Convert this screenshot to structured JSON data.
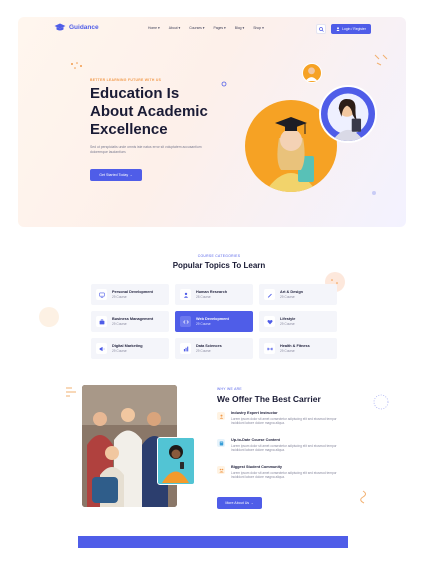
{
  "brand": {
    "name": "Guidance"
  },
  "nav": {
    "items": [
      {
        "label": "Home ▾"
      },
      {
        "label": "About ▾"
      },
      {
        "label": "Courses ▾"
      },
      {
        "label": "Pages ▾"
      },
      {
        "label": "Blog ▾"
      },
      {
        "label": "Shop ▾"
      }
    ],
    "login_label": "Login / Register"
  },
  "hero": {
    "subtitle": "BETTER LEARNING FUTURE WITH US",
    "title": "Education Is About Academic Excellence",
    "description": "Sed ut perspiciatis unde omnis iste natus error sit voluptatem accusantium doloremque laudantium.",
    "cta_label": "Get Started Today →"
  },
  "topics": {
    "subtitle": "COURSE CATEGORIES",
    "title": "Popular Topics To Learn",
    "items": [
      {
        "name": "Personal Development",
        "count": "29 Course",
        "icon": "monitor-icon",
        "active": false
      },
      {
        "name": "Human Research",
        "count": "28 Course",
        "icon": "people-icon",
        "active": false
      },
      {
        "name": "Art & Design",
        "count": "29 Course",
        "icon": "pen-icon",
        "active": false
      },
      {
        "name": "Business Management",
        "count": "29 Course",
        "icon": "briefcase-icon",
        "active": false
      },
      {
        "name": "Web Development",
        "count": "29 Course",
        "icon": "code-icon",
        "active": true
      },
      {
        "name": "Lifestyle",
        "count": "29 Course",
        "icon": "heart-icon",
        "active": false
      },
      {
        "name": "Digital Marketing",
        "count": "29 Course",
        "icon": "megaphone-icon",
        "active": false
      },
      {
        "name": "Data Sciences",
        "count": "29 Course",
        "icon": "chart-icon",
        "active": false
      },
      {
        "name": "Health & Fitness",
        "count": "29 Course",
        "icon": "dumbbell-icon",
        "active": false
      }
    ]
  },
  "why": {
    "subtitle": "WHY WE ARE",
    "title": "We Offer The Best Carrier",
    "features": [
      {
        "title": "Industry Expert Instructor",
        "description": "Lorem ipsum dolor sit amet consectetur adipiscing elit sed eiusmod tempor incididunt labore dolore magna aliqua."
      },
      {
        "title": "Up-to-Date Course Content",
        "description": "Lorem ipsum dolor sit amet consectetur adipiscing elit sed eiusmod tempor incididunt labore dolore magna aliqua."
      },
      {
        "title": "Biggest Student Community",
        "description": "Lorem ipsum dolor sit amet consectetur adipiscing elit sed eiusmod tempor incididunt labore dolore magna aliqua."
      }
    ],
    "cta_label": "More About Us →"
  },
  "colors": {
    "accent": "#4f5de8",
    "orange": "#f6a224",
    "heading": "#1a1b35"
  }
}
